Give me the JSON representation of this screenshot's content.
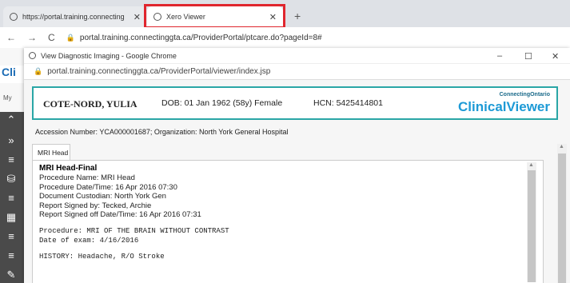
{
  "browser": {
    "tabs": [
      {
        "label": "https://portal.training.connecting",
        "active": false
      },
      {
        "label": "Xero Viewer",
        "active": true
      }
    ],
    "new_tab_symbol": "+",
    "nav": {
      "back": "←",
      "forward": "→",
      "reload": "C"
    },
    "url": "portal.training.connectinggta.ca/ProviderPortal/ptcare.do?pageId=8#",
    "highlight_color": "#e0262e"
  },
  "background_page": {
    "app_label": "Cli",
    "tab_fragment": "My",
    "side_icons": [
      "«",
      "»",
      "≡",
      "≡",
      "≡",
      "≡",
      "≡"
    ]
  },
  "popup": {
    "window_title": "View Diagnostic Imaging - Google Chrome",
    "window_controls": {
      "minimize": "–",
      "maximize": "☐",
      "close": "✕"
    },
    "url": "portal.training.connectinggta.ca/ProviderPortal/viewer/index.jsp",
    "patient": {
      "name": "COTE-NORD, YULIA",
      "dob": "DOB: 01 Jan 1962 (58y) Female",
      "hcn": "HCN: 5425414801"
    },
    "brand": {
      "top": "ConnectingOntario",
      "main": "ClinicalViewer"
    },
    "accession": "Accession Number: YCA000001687; Organization: North York General Hospital",
    "report_tab": "MRI Head",
    "report": {
      "title": "MRI Head-Final",
      "lines": [
        "Procedure Name: MRI Head",
        "Procedure Date/Time: 16 Apr 2016 07:30",
        "Document Custodian: North York Gen",
        "Report Signed by: Tecked, Archie",
        "Report Signed off Date/Time: 16 Apr 2016 07:31"
      ],
      "mono_block1": [
        "Procedure: MRI OF THE BRAIN WITHOUT CONTRAST",
        "Date of exam: 4/16/2016"
      ],
      "mono_block2": [
        "HISTORY: Headache, R/O Stroke"
      ]
    },
    "colors": {
      "banner_border": "#2aa6a6",
      "brand_blue": "#1d9ad6"
    }
  }
}
